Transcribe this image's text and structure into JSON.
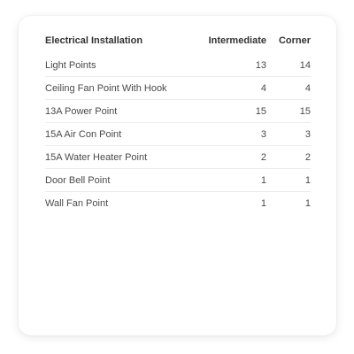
{
  "table": {
    "headers": {
      "item": "Electrical Installation",
      "intermediate": "Intermediate",
      "corner": "Corner"
    },
    "rows": [
      {
        "item": "Light Points",
        "intermediate": "13",
        "corner": "14"
      },
      {
        "item": "Ceiling Fan Point With Hook",
        "intermediate": "4",
        "corner": "4"
      },
      {
        "item": "13A Power Point",
        "intermediate": "15",
        "corner": "15"
      },
      {
        "item": "15A Air Con Point",
        "intermediate": "3",
        "corner": "3"
      },
      {
        "item": "15A Water Heater Point",
        "intermediate": "2",
        "corner": "2"
      },
      {
        "item": "Door Bell Point",
        "intermediate": "1",
        "corner": "1"
      },
      {
        "item": "Wall Fan Point",
        "intermediate": "1",
        "corner": "1"
      }
    ]
  }
}
